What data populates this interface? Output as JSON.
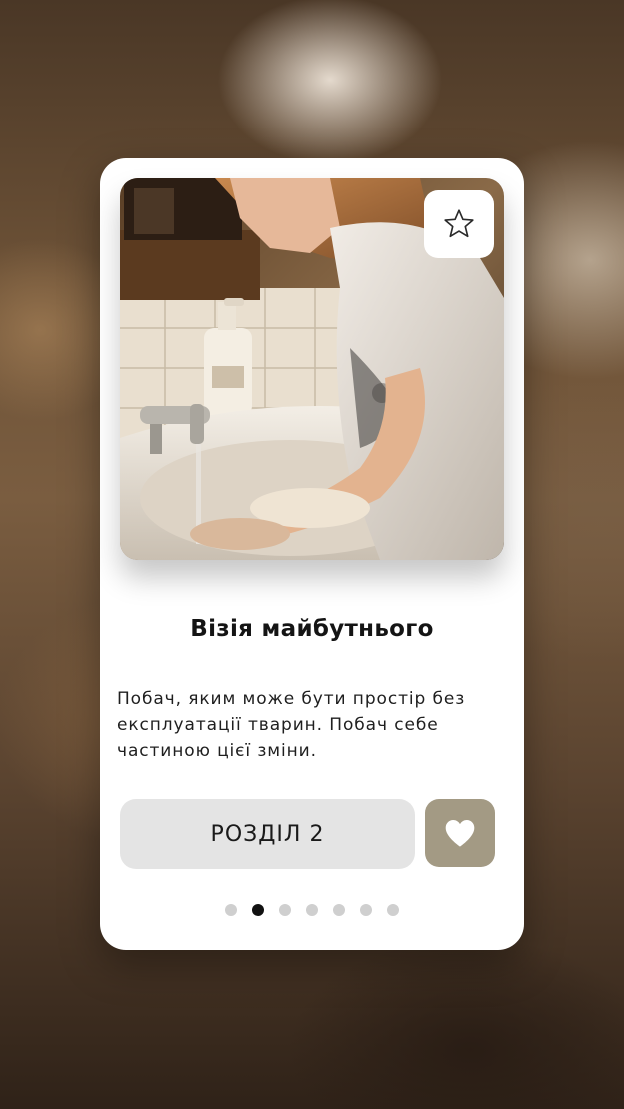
{
  "card": {
    "title": "Візія майбутнього",
    "description": "Побач, яким може бути простір без експлуатації тварин. Побач себе частиною цієї зміни.",
    "section_button_label": "РОЗДІЛ 2",
    "favorite_icon": "star-outline-icon",
    "like_icon": "heart-icon"
  },
  "pagination": {
    "total": 7,
    "active_index": 1
  },
  "colors": {
    "card_background": "#ffffff",
    "section_button": "#e4e4e4",
    "like_button": "#a39a84",
    "dot_active": "#111111",
    "dot_inactive": "#cfcfcf"
  }
}
